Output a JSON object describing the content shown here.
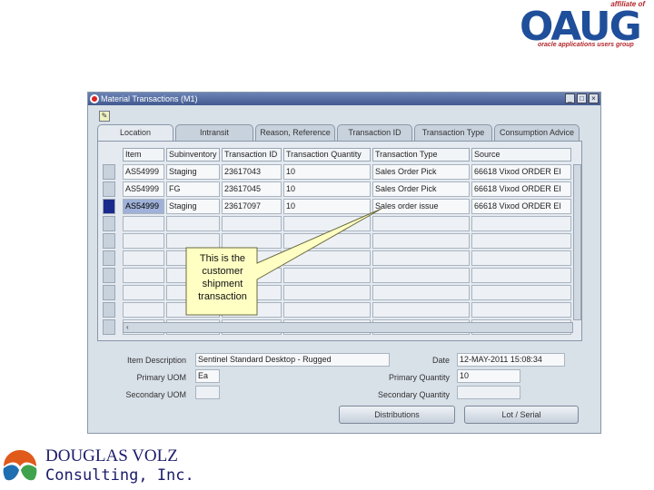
{
  "oaug_logo": {
    "affiliate": "affiliate of",
    "word": "OAUG",
    "tagline": "oracle applications users group"
  },
  "window": {
    "title": "Material Transactions (M1)",
    "tabs": [
      "Location",
      "Intransit",
      "Reason, Reference",
      "Transaction ID",
      "Transaction Type",
      "Consumption Advice"
    ],
    "columns": [
      "Item",
      "Subinventory",
      "Transaction ID",
      "Transaction Quantity",
      "Transaction Type",
      "Source"
    ],
    "rows": [
      [
        "AS54999",
        "Staging",
        "23617043",
        "10",
        "Sales Order Pick",
        "66618 Vixod ORDER EI"
      ],
      [
        "AS54999",
        "FG",
        "23617045",
        "10",
        "Sales Order Pick",
        "66618 Vixod ORDER EI"
      ],
      [
        "AS54999",
        "Staging",
        "23617097",
        "10",
        "Sales order issue",
        "66618 Vixod ORDER EI"
      ]
    ],
    "details": {
      "item_description_label": "Item Description",
      "item_description_value": "Sentinel Standard Desktop - Rugged",
      "date_label": "Date",
      "date_value": "12-MAY-2011 15:08:34",
      "primary_uom_label": "Primary UOM",
      "primary_uom_value": "Ea",
      "primary_quantity_label": "Primary Quantity",
      "primary_quantity_value": "10",
      "secondary_uom_label": "Secondary UOM",
      "secondary_quantity_label": "Secondary Quantity"
    },
    "buttons": {
      "distributions": "Distributions",
      "lot_serial": "Lot / Serial"
    }
  },
  "callout": {
    "lines": [
      "This is the",
      "customer",
      "shipment",
      "transaction"
    ]
  },
  "dv_logo": {
    "line1": "DOUGLAS VOLZ",
    "line2": "Consulting, Inc."
  }
}
